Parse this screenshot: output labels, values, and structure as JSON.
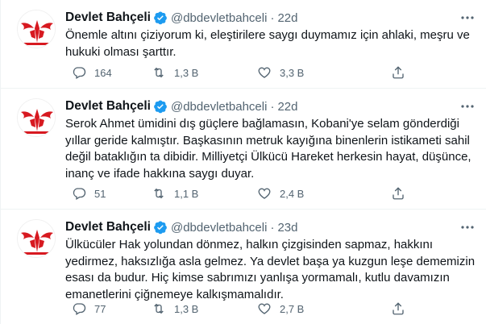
{
  "accent_color": "#1d9bf0",
  "icons": {
    "verified": "verified-badge-icon",
    "more": "more-dots-icon",
    "reply": "reply-icon",
    "retweet": "retweet-icon",
    "like": "heart-icon",
    "share": "share-icon"
  },
  "tweets": [
    {
      "name": "Devlet Bahçeli",
      "handle": "@dbdevletbahceli",
      "sep": "·",
      "time": "22d",
      "lines": [
        "Önemle altını çiziyorum ki, eleştirilere saygı duymamız için ahlaki, meşru ve",
        "hukuki olması şarttır."
      ],
      "replies": "164",
      "retweets": "1,3 B",
      "likes": "3,3 B"
    },
    {
      "name": "Devlet Bahçeli",
      "handle": "@dbdevletbahceli",
      "sep": "·",
      "time": "22d",
      "lines": [
        "Serok Ahmet ümidini dış güçlere bağlamasın, Kobani'ye selam gönderdiği",
        "yıllar geride kalmıştır. Başkasının metruk kayığına binenlerin istikameti sahil",
        "değil bataklığın ta dibidir. Milliyetçi Ülkücü Hareket herkesin hayat, düşünce,",
        "inanç ve ifade hakkına saygı duyar."
      ],
      "replies": "51",
      "retweets": "1,1 B",
      "likes": "2,4 B"
    },
    {
      "name": "Devlet Bahçeli",
      "handle": "@dbdevletbahceli",
      "sep": "·",
      "time": "23d",
      "lines": [
        "Ülkücüler Hak yolundan dönmez, halkın çizgisinden sapmaz, hakkını",
        "yedirmez, haksızlığa asla gelmez. Ya devlet başa ya kuzgun leşe dememizin",
        "esası da budur. Hiç kimse sabrımızı yanlışa yormamalı, kutlu davamızın",
        "emanetlerini çiğnemeye kalkışmamalıdır."
      ],
      "replies": "77",
      "retweets": "1,3 B",
      "likes": "2,7 B"
    }
  ]
}
